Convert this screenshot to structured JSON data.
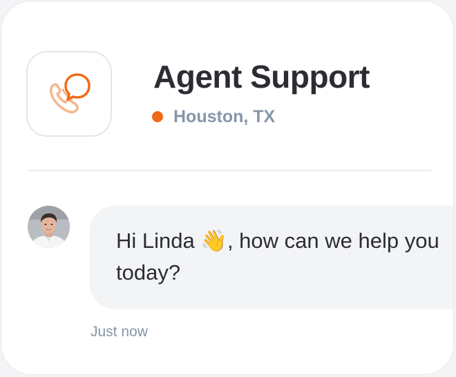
{
  "header": {
    "icon": "phone-chat-icon",
    "title": "Agent Support",
    "location": "Houston, TX",
    "status_color": "#f26a16"
  },
  "chat": {
    "avatar": "agent-avatar",
    "message": "Hi Linda 👋, how can we help you today?",
    "timestamp": "Just now"
  },
  "colors": {
    "accent": "#f26a16",
    "muted_text": "#8795a8",
    "bubble_bg": "#f3f4f6"
  }
}
